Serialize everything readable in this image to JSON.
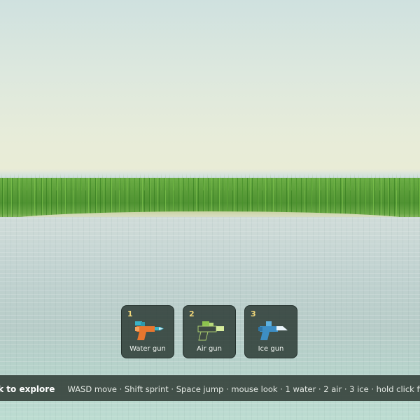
{
  "hotbar": {
    "slots": [
      {
        "key": "1",
        "label": "Water gun",
        "icon": "water-gun-icon",
        "colors": {
          "body": "#e8762e",
          "tank": "#39b2c7",
          "tip": "#cfe7ef"
        }
      },
      {
        "key": "2",
        "label": "Air gun",
        "icon": "air-gun-icon",
        "colors": {
          "body": "#3e4a44",
          "tank": "#8cc24e",
          "tip": "#d6ec9c"
        }
      },
      {
        "key": "3",
        "label": "Ice gun",
        "icon": "ice-gun-icon",
        "colors": {
          "body": "#3d8ec4",
          "tank": "#5db0de",
          "tip": "#eaf5fb"
        }
      }
    ]
  },
  "hint_bar": {
    "title": "Click to explore",
    "controls": "WASD move · Shift sprint · Space jump · mouse look · 1 water · 2 air · 3 ice · hold click fire · Esc pause"
  }
}
